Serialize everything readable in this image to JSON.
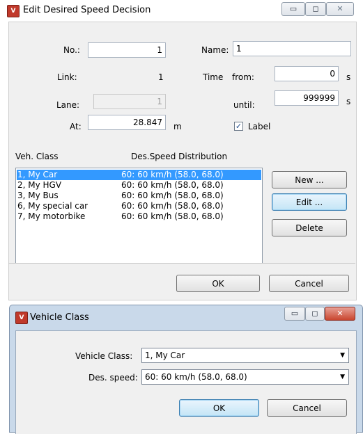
{
  "dialog1": {
    "title": "Edit Desired Speed Decision",
    "no_label": "No.:",
    "no_value": "1",
    "name_label": "Name:",
    "name_value": "1",
    "link_label": "Link:",
    "link_value": "1",
    "time_label": "Time",
    "from_label": "from:",
    "from_value": "0",
    "from_unit": "s",
    "lane_label": "Lane:",
    "lane_value": "1",
    "until_label": "until:",
    "until_value": "999999",
    "until_unit": "s",
    "at_label": "At:",
    "at_value": "28.847",
    "at_unit": "m",
    "label_checkbox": "Label",
    "label_checked": true,
    "col_vehclass": "Veh. Class",
    "col_speed": "Des.Speed Distribution",
    "rows": [
      {
        "cls": "1, My Car",
        "speed": "60: 60 km/h (58.0, 68.0)",
        "selected": true
      },
      {
        "cls": "2, My HGV",
        "speed": "60: 60 km/h (58.0, 68.0)",
        "selected": false
      },
      {
        "cls": "3, My Bus",
        "speed": "60: 60 km/h (58.0, 68.0)",
        "selected": false
      },
      {
        "cls": "6, My special car",
        "speed": "60: 60 km/h (58.0, 68.0)",
        "selected": false
      },
      {
        "cls": "7, My motorbike",
        "speed": "60: 60 km/h (58.0, 68.0)",
        "selected": false
      }
    ],
    "new_button": "New ...",
    "edit_button": "Edit ...",
    "delete_button": "Delete",
    "ok_button": "OK",
    "cancel_button": "Cancel"
  },
  "dialog2": {
    "title": "Vehicle Class",
    "vehclass_label": "Vehicle Class:",
    "vehclass_value": "1, My Car",
    "speed_label": "Des. speed:",
    "speed_value": "60: 60 km/h (58.0, 68.0)",
    "ok_button": "OK",
    "cancel_button": "Cancel"
  },
  "icons": {
    "minimize": "minimize-icon",
    "maximize": "maximize-icon",
    "close": "close-icon",
    "dropdown": "chevron-down-icon",
    "app": "vissim-app-icon"
  },
  "colors": {
    "dialog_bg": "#f0f0f0",
    "selection": "#3399ff",
    "frame": "#c9d9ea"
  }
}
